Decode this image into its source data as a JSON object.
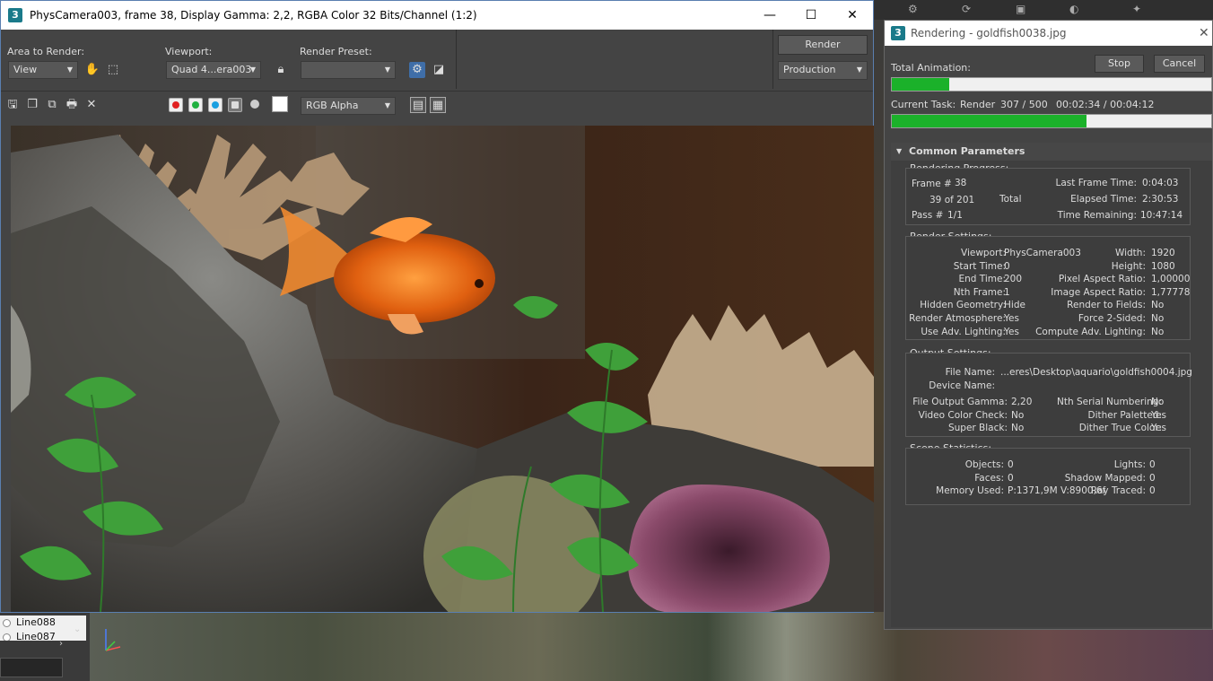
{
  "background": {
    "list_items": [
      "Line088",
      "Line087"
    ]
  },
  "frame_window": {
    "title": "PhysCamera003, frame 38, Display Gamma: 2,2, RGBA Color 32 Bits/Channel (1:2)",
    "app_icon": "3",
    "area_to_render_label": "Area to Render:",
    "area_to_render_value": "View",
    "viewport_label": "Viewport:",
    "viewport_value": "Quad 4...era003",
    "render_preset_label": "Render Preset:",
    "render_preset_value": "",
    "render_button": "Render",
    "production_value": "Production",
    "channel_display": "RGB Alpha",
    "colors": {
      "red": "#e02020",
      "green": "#20b040",
      "blue": "#1a9fe0"
    }
  },
  "render_dialog": {
    "title": "Rendering - goldfish0038.jpg",
    "app_icon": "3",
    "total_animation_label": "Total Animation:",
    "stop_button": "Stop",
    "cancel_button": "Cancel",
    "total_progress": 0.18,
    "current_task_label": "Current Task:",
    "current_task_value": "Render",
    "current_task_count": "307 / 500",
    "current_task_time": "00:02:34 / 00:04:12",
    "current_progress": 0.61,
    "common_parameters_header": "Common Parameters",
    "rendering_progress": {
      "title": "Rendering Progress:",
      "frame_label": "Frame #",
      "frame_value": "38",
      "of_value": "39 of 201",
      "total_label": "Total",
      "pass_label": "Pass #",
      "pass_value": "1/1",
      "last_frame_time_label": "Last Frame Time:",
      "last_frame_time_value": "0:04:03",
      "elapsed_time_label": "Elapsed Time:",
      "elapsed_time_value": "2:30:53",
      "time_remaining_label": "Time Remaining:",
      "time_remaining_value": "10:47:14"
    },
    "render_settings": {
      "title": "Render Settings:",
      "left": [
        {
          "label": "Viewport:",
          "value": "PhysCamera003"
        },
        {
          "label": "Start Time:",
          "value": "0"
        },
        {
          "label": "End Time:",
          "value": "200"
        },
        {
          "label": "Nth Frame:",
          "value": "1"
        },
        {
          "label": "Hidden Geometry:",
          "value": "Hide"
        },
        {
          "label": "Render Atmosphere:",
          "value": "Yes"
        },
        {
          "label": "Use Adv. Lighting:",
          "value": "Yes"
        }
      ],
      "right": [
        {
          "label": "Width:",
          "value": "1920"
        },
        {
          "label": "Height:",
          "value": "1080"
        },
        {
          "label": "Pixel Aspect Ratio:",
          "value": "1,00000"
        },
        {
          "label": "Image Aspect Ratio:",
          "value": "1,77778"
        },
        {
          "label": "Render to Fields:",
          "value": "No"
        },
        {
          "label": "Force 2-Sided:",
          "value": "No"
        },
        {
          "label": "Compute Adv. Lighting:",
          "value": "No"
        }
      ]
    },
    "output_settings": {
      "title": "Output Settings:",
      "file_name_label": "File Name:",
      "file_name_value": "...eres\\Desktop\\aquario\\goldfish0004.jpg",
      "device_name_label": "Device Name:",
      "device_name_value": "",
      "left": [
        {
          "label": "File Output Gamma:",
          "value": "2,20"
        },
        {
          "label": "Video Color Check:",
          "value": "No"
        },
        {
          "label": "Super Black:",
          "value": "No"
        }
      ],
      "right": [
        {
          "label": "Nth Serial Numbering:",
          "value": "No"
        },
        {
          "label": "Dither Paletted:",
          "value": "Yes"
        },
        {
          "label": "Dither True Color:",
          "value": "Yes"
        }
      ]
    },
    "scene_statistics": {
      "title": "Scene Statistics:",
      "left": [
        {
          "label": "Objects:",
          "value": "0"
        },
        {
          "label": "Faces:",
          "value": "0"
        },
        {
          "label": "Memory Used:",
          "value": "P:1371,9M V:8900,6f"
        }
      ],
      "right": [
        {
          "label": "Lights:",
          "value": "0"
        },
        {
          "label": "Shadow Mapped:",
          "value": "0"
        },
        {
          "label": "Ray Traced:",
          "value": "0"
        }
      ]
    }
  }
}
